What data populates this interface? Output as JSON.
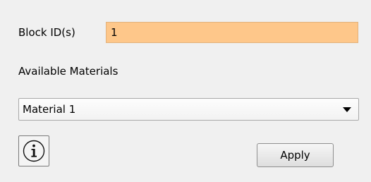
{
  "block": {
    "label": "Block ID(s)",
    "value": "1"
  },
  "materials": {
    "label": "Available Materials",
    "selected": "Material 1"
  },
  "buttons": {
    "apply_label": "Apply"
  },
  "icons": {
    "info": "info-icon",
    "dropdown": "chevron-down-icon"
  },
  "colors": {
    "block_input_background": "#fec78a",
    "window_background": "#f0f0f0"
  }
}
